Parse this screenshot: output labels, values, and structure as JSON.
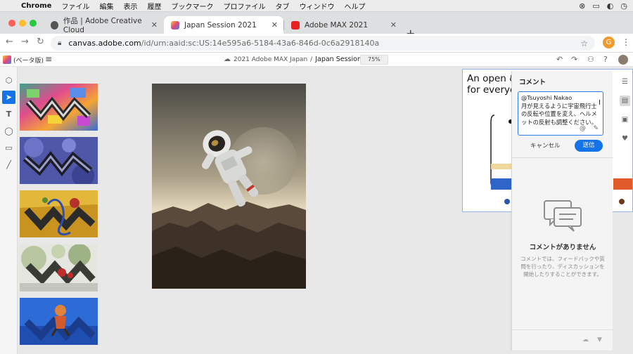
{
  "menubar": {
    "app": "Chrome",
    "items": [
      "ファイル",
      "編集",
      "表示",
      "履歴",
      "ブックマーク",
      "プロファイル",
      "タブ",
      "ウィンドウ",
      "ヘルプ"
    ]
  },
  "tabs": [
    {
      "label": "作品 | Adobe Creative Cloud",
      "active": false
    },
    {
      "label": "Japan Session 2021",
      "active": true
    },
    {
      "label": "Adobe MAX 2021",
      "active": false
    }
  ],
  "address": {
    "host": "canvas.adobe.com",
    "path": "/id/urn:aaid:sc:US:14e595a6-5184-43a6-846d-0c6a2918140a"
  },
  "profile_initial": "G",
  "app_header": {
    "beta": "(ベータ版)",
    "breadcrumb_parent": "2021 Adobe MAX Japan",
    "separator": "/",
    "doc_title": "Japan Session 2021",
    "zoom": "75%"
  },
  "board": {
    "headline_line1": "An open &",
    "headline_line2": "for everyon"
  },
  "comment_panel": {
    "title": "コメント",
    "draft_mention": "@Tsuyoshi Nakao",
    "draft_body": "月が見えるように宇宙飛行士の反転や位置を変え、ヘルメットの反射も調整ください。",
    "cancel": "キャンセル",
    "send": "送信",
    "empty_title": "コメントがありません",
    "empty_desc": "コメントでは、フィードバックや質問を行ったり、ディスカッションを開始したりすることができます。"
  },
  "colors": {
    "accent": "#1473e6",
    "tab_strip": "#dedfe1"
  }
}
